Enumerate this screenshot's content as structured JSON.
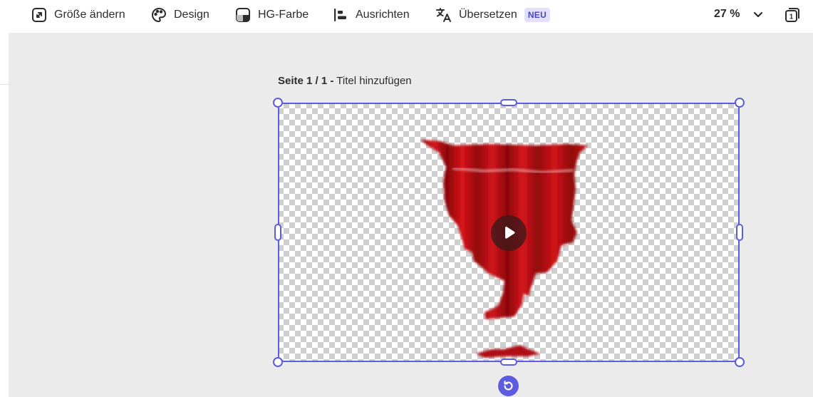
{
  "toolbar": {
    "resize_label": "Größe ändern",
    "design_label": "Design",
    "bg_color_label": "HG-Farbe",
    "align_label": "Ausrichten",
    "translate_label": "Übersetzen",
    "translate_badge": "NEU",
    "zoom_value": "27 %",
    "page_count": "1"
  },
  "page": {
    "page_indicator": "Seite 1 / 1 -",
    "title_placeholder": "Titel hinzufügen"
  },
  "colors": {
    "selection": "#5c5ce0",
    "badge_bg": "#e2e0fb",
    "badge_text": "#4b45c8",
    "curtain_red": "#b80c12"
  },
  "icons": {
    "resize": "resize-icon",
    "design": "palette-icon",
    "bg_color": "background-color-icon",
    "align": "align-left-icon",
    "translate": "translate-icon",
    "zoom": "chevron-down-icon",
    "pages": "pages-icon",
    "play": "play-icon",
    "rotate": "rotate-icon"
  }
}
